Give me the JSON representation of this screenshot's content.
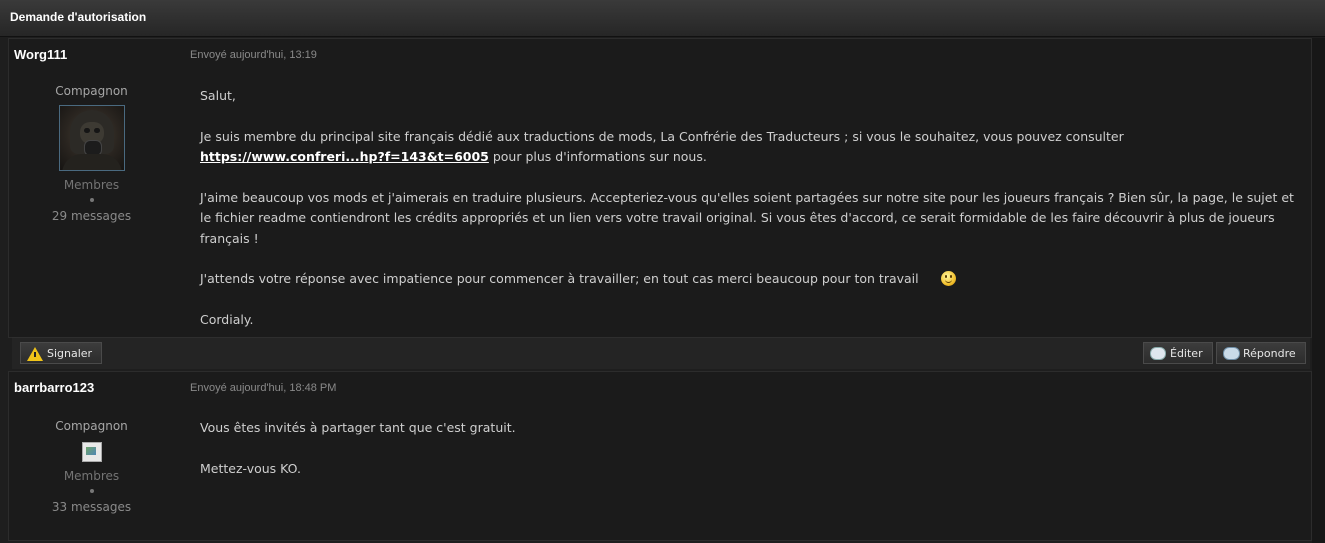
{
  "window": {
    "title": "Demande d'autorisation"
  },
  "posts": [
    {
      "author": "Worg111",
      "sent": "Envoyé aujourd'hui, 13:19",
      "rank": "Compagnon",
      "group": "Membres",
      "messages": "29 messages",
      "body": {
        "p1": "Salut,",
        "p2a": "Je suis membre du principal site français dédié aux traductions de mods, La Confrérie des Traducteurs ; si vous le souhaitez, vous pouvez consulter",
        "link": "https://www.confreri...hp?f=143&t=6005",
        "p2b": " pour plus d'informations sur nous.",
        "p3": "J'aime beaucoup vos mods et j'aimerais en traduire plusieurs. Accepteriez-vous qu'elles soient partagées sur notre site pour les joueurs français ? Bien sûr, la page, le sujet et le fichier readme contiendront les crédits appropriés et un lien vers votre travail original. Si vous êtes d'accord, ce serait formidable de les faire découvrir à plus de joueurs français !",
        "p4": "J'attends votre réponse avec impatience pour commencer à travailler; en tout cas merci beaucoup pour ton travail",
        "p5": "Cordialy."
      }
    },
    {
      "author": "barrbarro123",
      "sent": "Envoyé aujourd'hui, 18:48 PM",
      "rank": "Compagnon",
      "group": "Membres",
      "messages": "33 messages",
      "body": {
        "p1": "Vous êtes invités à partager tant que c'est gratuit.",
        "p2": "Mettez-vous KO."
      }
    }
  ],
  "actions": {
    "report": "Signaler",
    "edit": "Éditer",
    "reply": "Répondre"
  },
  "icons": {
    "report": "warning-icon",
    "edit": "edit-bubble-icon",
    "reply": "reply-bubble-icon",
    "smiley": "wink-smiley-icon"
  }
}
